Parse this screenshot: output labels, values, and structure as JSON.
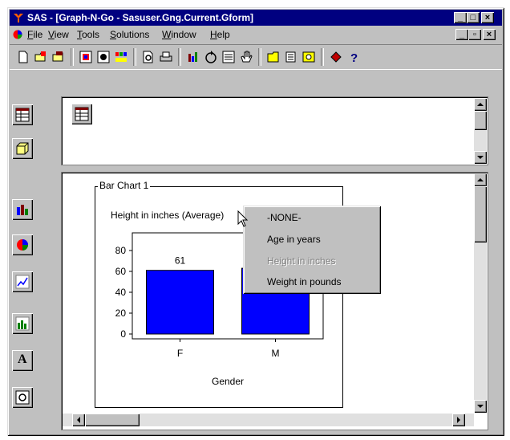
{
  "window": {
    "title": "SAS - [Graph-N-Go - Sasuser.Gng.Current.Gform]"
  },
  "menubar": {
    "items": [
      {
        "label": "File",
        "accel": "F",
        "rest": "ile"
      },
      {
        "label": "View",
        "accel": "V",
        "rest": "iew"
      },
      {
        "label": "Tools",
        "accel": "T",
        "rest": "ools"
      },
      {
        "label": "Solutions",
        "accel": "S",
        "rest": "olutions"
      },
      {
        "label": "Window",
        "accel": "W",
        "rest": "indow"
      },
      {
        "label": "Help",
        "accel": "H",
        "rest": "elp"
      }
    ]
  },
  "toolbar": {
    "icons": [
      "new-icon",
      "open-icon",
      "save-icon",
      "properties-icon",
      "graph-properties-icon",
      "color-icon",
      "print-preview-icon",
      "print-icon",
      "bar-chart-icon",
      "refresh-icon",
      "data-icon",
      "hand-icon",
      "explorer-icon",
      "library-icon",
      "query-icon",
      "book-icon",
      "help-icon"
    ]
  },
  "sidebar": {
    "icons": [
      "table-viewer-icon",
      "data-model-icon",
      "bar-chart-tool-icon",
      "pie-chart-tool-icon",
      "plot-tool-icon",
      "line-chart-tool-icon",
      "text-tool-icon",
      "viewer-tool-icon"
    ],
    "text_tool_label": "A"
  },
  "group": {
    "label": "Bar Chart 1"
  },
  "chart_data": {
    "type": "bar",
    "title": "Height in inches (Average)",
    "categories": [
      "F",
      "M"
    ],
    "values": [
      61,
      63
    ],
    "visible_value_labels": [
      "61"
    ],
    "xlabel": "Gender",
    "ylabel": "",
    "yticks": [
      "0",
      "20",
      "40",
      "60",
      "80"
    ],
    "ylim": [
      0,
      90
    ],
    "bar_color": "#0000ff",
    "grid": false
  },
  "context_menu": {
    "items": [
      {
        "label": "-NONE-",
        "enabled": true
      },
      {
        "label": "Age in years",
        "enabled": true
      },
      {
        "label": "Height in inches",
        "enabled": false
      },
      {
        "label": "Weight in pounds",
        "enabled": true
      }
    ]
  },
  "colors": {
    "titlebar": "#000080",
    "face": "#c0c0c0",
    "bar": "#0000ff"
  }
}
